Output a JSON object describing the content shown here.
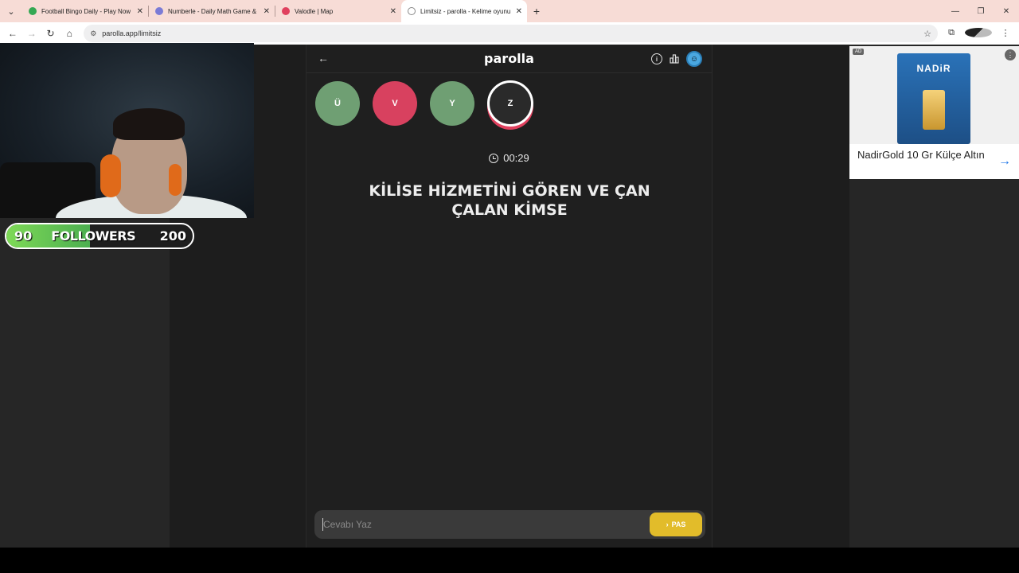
{
  "browser": {
    "tabs": [
      {
        "title": "Football Bingo Daily - Play Now",
        "favicon_color": "#34a853"
      },
      {
        "title": "Numberle - Daily Math Game &",
        "favicon_color": "#7b7bd6"
      },
      {
        "title": "Valodle | Map",
        "favicon_color": "#e0405e"
      },
      {
        "title": "Limitsiz - parolla - Kelime oyunu",
        "favicon_color": "#888888",
        "active": true
      }
    ],
    "url": "parolla.app/limitsiz"
  },
  "stream": {
    "followers_current": "90",
    "followers_label": "FOLLOWERS",
    "followers_goal": "200"
  },
  "game": {
    "logo": "parolla",
    "letters": [
      {
        "char": "Ü",
        "state": "correct"
      },
      {
        "char": "V",
        "state": "wrong"
      },
      {
        "char": "Y",
        "state": "correct"
      },
      {
        "char": "Z",
        "state": "current"
      }
    ],
    "timer": "00:29",
    "question": "KİLİSE HİZMETİNİ GÖREN VE ÇAN ÇALAN KİMSE",
    "answer_placeholder": "Cevabı Yaz",
    "pass_label": "PAS"
  },
  "ad": {
    "badge": "AD",
    "brand": "NADiR",
    "text": "NadirGold 10 Gr Külçe Altın"
  },
  "colors": {
    "correct": "#6f9f73",
    "wrong": "#d8415f",
    "pass_button": "#e2bc2a"
  }
}
